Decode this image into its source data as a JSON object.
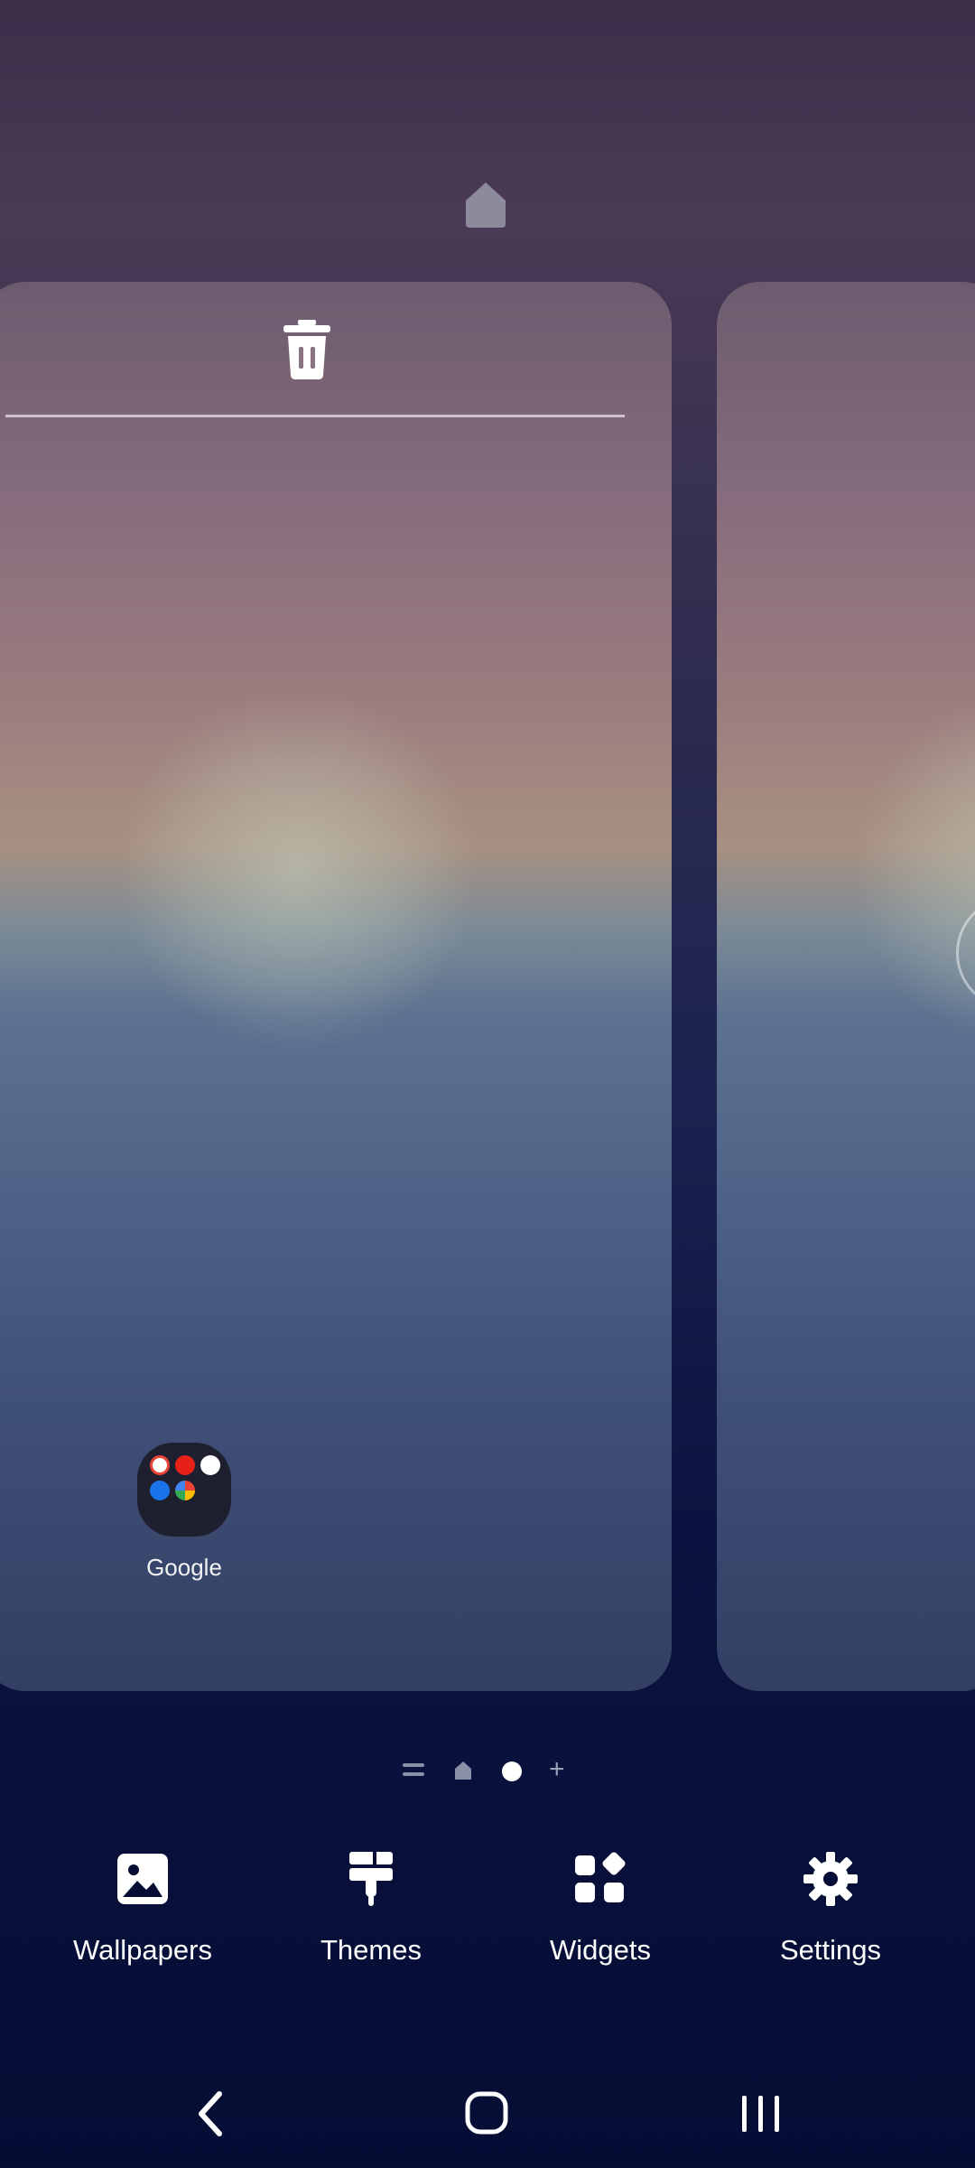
{
  "home_pages": {
    "folder": {
      "label": "Google"
    }
  },
  "actions": [
    {
      "label": "Wallpapers",
      "icon": "wallpaper-icon"
    },
    {
      "label": "Themes",
      "icon": "paintbrush-icon"
    },
    {
      "label": "Widgets",
      "icon": "widgets-icon"
    },
    {
      "label": "Settings",
      "icon": "gear-icon"
    }
  ],
  "page_indicator": {
    "items": [
      "menu-icon",
      "home-icon",
      "current-page-dot",
      "add-icon"
    ],
    "plus_glyph": "+"
  },
  "navigation": [
    "back-icon",
    "home-icon",
    "recents-icon"
  ],
  "colors": {
    "background": "#050d35",
    "accent": "#ffffff"
  }
}
